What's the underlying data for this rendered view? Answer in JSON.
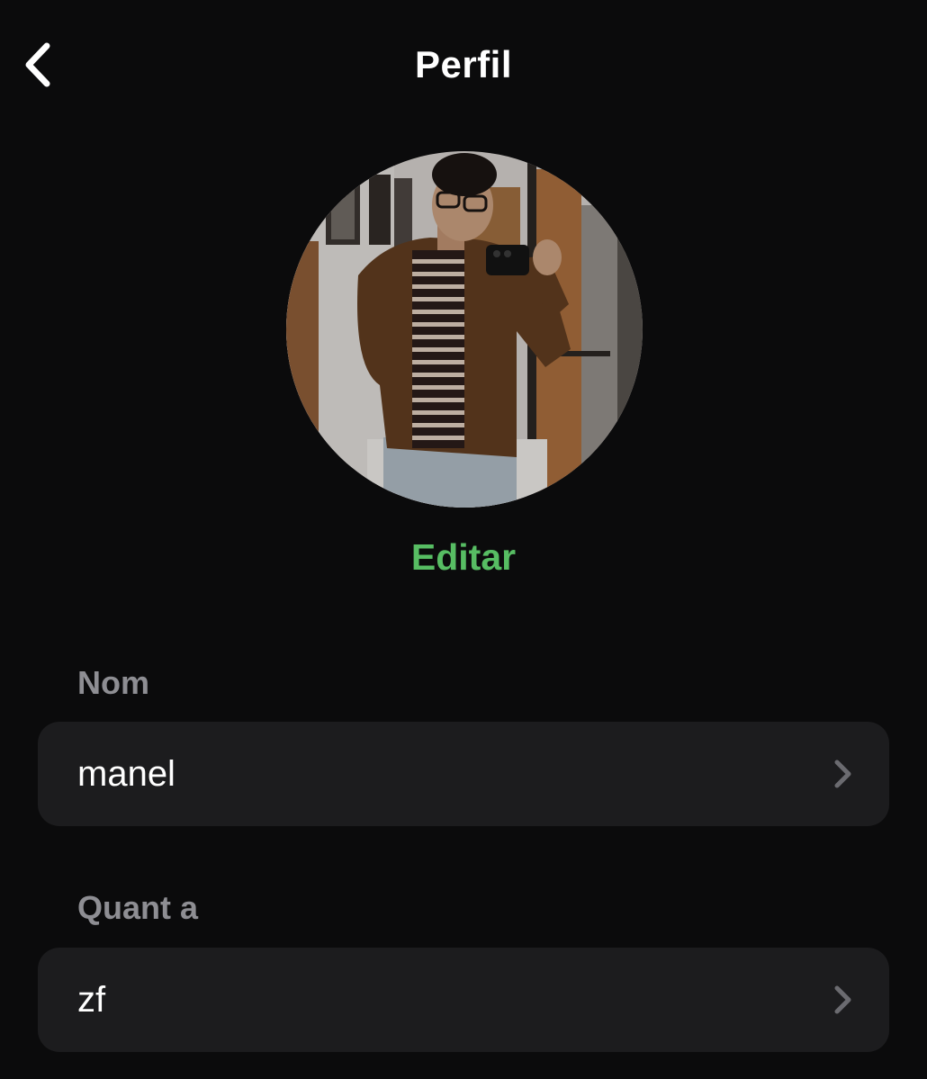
{
  "header": {
    "title": "Perfil",
    "back_icon": "chevron-left-icon"
  },
  "profile": {
    "edit_label": "Editar"
  },
  "fields": [
    {
      "label": "Nom",
      "value": "manel",
      "icon": "chevron-right-icon"
    },
    {
      "label": "Quant a",
      "value": "zf",
      "icon": "chevron-right-icon"
    }
  ],
  "colors": {
    "background": "#0b0b0c",
    "card": "#1c1c1e",
    "accent": "#57bd63",
    "label": "#8e8e93"
  }
}
